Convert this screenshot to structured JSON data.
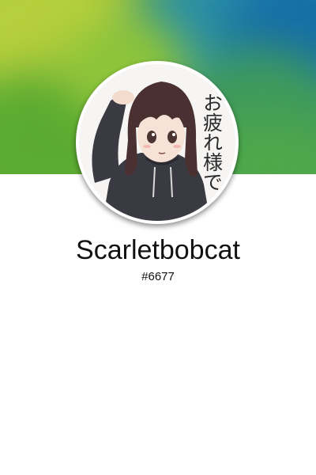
{
  "profile": {
    "username": "Scarletbobcat",
    "discriminator": "#6677",
    "avatar_text": "お疲れ様で"
  },
  "colors": {
    "banner_green": "#6fae3a",
    "banner_blue": "#166ea8",
    "text": "#111111",
    "background": "#ffffff"
  }
}
